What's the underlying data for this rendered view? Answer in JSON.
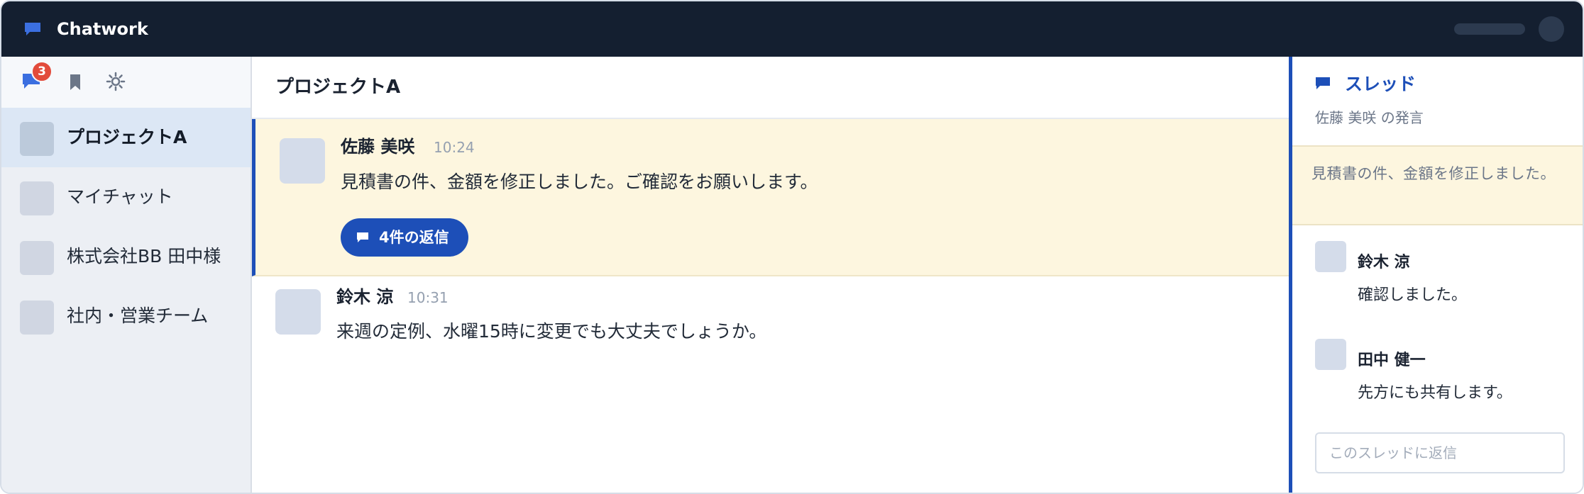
{
  "app": {
    "title": "Chatwork",
    "accent": "#1d4fb8",
    "topbar_color": "#141f30"
  },
  "sidebar": {
    "toolbar": {
      "chat_icon": "chat-bubble-icon",
      "unread_badge": "3",
      "bookmark_icon": "bookmark-icon",
      "settings_icon": "gear-icon"
    },
    "rooms": [
      {
        "name": "プロジェクトA",
        "active": true
      },
      {
        "name": "マイチャット",
        "active": false
      },
      {
        "name": "株式会社BB 田中様",
        "active": false
      },
      {
        "name": "社内・営業チーム",
        "active": false
      }
    ]
  },
  "main": {
    "title": "プロジェクトA",
    "messages": [
      {
        "author": "佐藤 美咲",
        "time": "10:24",
        "text": "見積書の件、金額を修正しました。ご確認をお願いします。",
        "reply_button": "4件の返信",
        "highlighted": true
      },
      {
        "author": "鈴木 涼",
        "time": "10:31",
        "text": "来週の定例、水曜15時に変更でも大丈夫でしょうか。",
        "highlighted": false
      }
    ]
  },
  "thread": {
    "title": "スレッド",
    "subtitle": "佐藤 美咲 の発言",
    "quote": "見積書の件、金額を修正しました。",
    "replies": [
      {
        "author": "鈴木 涼",
        "text": "確認しました。"
      },
      {
        "author": "田中 健一",
        "text": "先方にも共有します。"
      }
    ],
    "input_placeholder": "このスレッドに返信"
  }
}
